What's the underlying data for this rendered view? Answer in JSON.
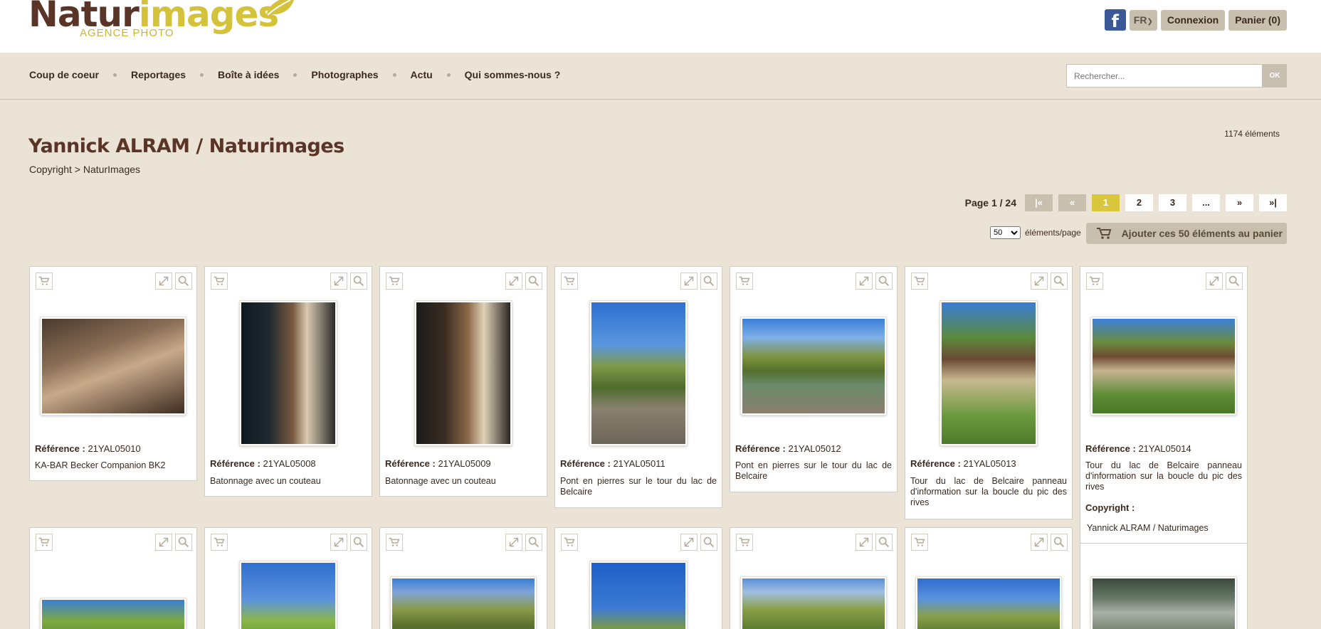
{
  "brand": {
    "name_part1": "Natur",
    "name_part2": "images",
    "tagline": "AGENCE PHOTO"
  },
  "header": {
    "facebook": "f",
    "lang": "FR",
    "login": "Connexion",
    "cart": "Panier  (0)"
  },
  "nav": {
    "items": [
      "Coup de coeur",
      "Reportages",
      "Boîte à idées",
      "Photographes",
      "Actu",
      "Qui sommes-nous ?"
    ]
  },
  "search": {
    "placeholder": "Rechercher...",
    "button": "OK"
  },
  "page": {
    "count": "1174 éléments",
    "title": "Yannick ALRAM / Naturimages",
    "breadcrumb": "Copyright > NaturImages"
  },
  "pagination": {
    "label": "Page 1 / 24",
    "first": "|«",
    "prev": "«",
    "pages": [
      "1",
      "2",
      "3",
      "..."
    ],
    "next": "»",
    "last": "»|"
  },
  "per_page": {
    "value": "50",
    "label": "éléments/page",
    "add_all": "Ajouter ces 50 éléments au panier"
  },
  "ref_label": "Référence :",
  "copyright_label": "Copyright :",
  "cards": [
    {
      "ref": "21YAL05010",
      "desc": "KA-BAR Becker Companion BK2"
    },
    {
      "ref": "21YAL05008",
      "desc": "Batonnage avec un couteau"
    },
    {
      "ref": "21YAL05009",
      "desc": "Batonnage avec un couteau"
    },
    {
      "ref": "21YAL05011",
      "desc": "Pont en pierres sur le tour du lac de Belcaire"
    },
    {
      "ref": "21YAL05012",
      "desc": "Pont en pierres sur le tour du lac de Belcaire"
    },
    {
      "ref": "21YAL05013",
      "desc": "Tour du lac de Belcaire panneau d'information sur la boucle du pic des rives"
    },
    {
      "ref": "21YAL05014",
      "desc": "Tour du lac de Belcaire panneau d'information sur la boucle du pic des rives",
      "copyright": "Yannick ALRAM / Naturimages"
    }
  ],
  "colors": {
    "accent": "#d9c63d",
    "background": "#ebe3d6",
    "title": "#5a3426",
    "button": "#c8bfae"
  }
}
